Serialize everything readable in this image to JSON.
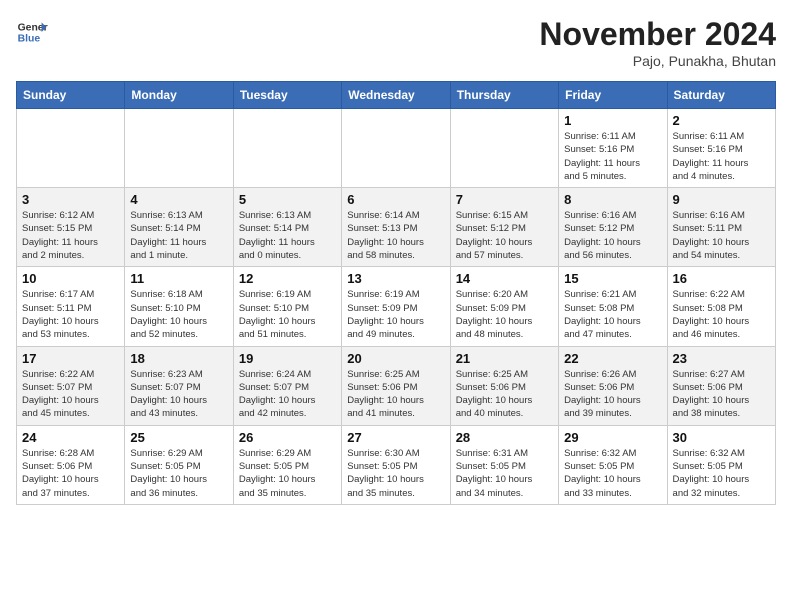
{
  "header": {
    "logo_line1": "General",
    "logo_line2": "Blue",
    "title": "November 2024",
    "subtitle": "Pajo, Punakha, Bhutan"
  },
  "weekdays": [
    "Sunday",
    "Monday",
    "Tuesday",
    "Wednesday",
    "Thursday",
    "Friday",
    "Saturday"
  ],
  "weeks": [
    [
      {
        "day": "",
        "info": ""
      },
      {
        "day": "",
        "info": ""
      },
      {
        "day": "",
        "info": ""
      },
      {
        "day": "",
        "info": ""
      },
      {
        "day": "",
        "info": ""
      },
      {
        "day": "1",
        "info": "Sunrise: 6:11 AM\nSunset: 5:16 PM\nDaylight: 11 hours\nand 5 minutes."
      },
      {
        "day": "2",
        "info": "Sunrise: 6:11 AM\nSunset: 5:16 PM\nDaylight: 11 hours\nand 4 minutes."
      }
    ],
    [
      {
        "day": "3",
        "info": "Sunrise: 6:12 AM\nSunset: 5:15 PM\nDaylight: 11 hours\nand 2 minutes."
      },
      {
        "day": "4",
        "info": "Sunrise: 6:13 AM\nSunset: 5:14 PM\nDaylight: 11 hours\nand 1 minute."
      },
      {
        "day": "5",
        "info": "Sunrise: 6:13 AM\nSunset: 5:14 PM\nDaylight: 11 hours\nand 0 minutes."
      },
      {
        "day": "6",
        "info": "Sunrise: 6:14 AM\nSunset: 5:13 PM\nDaylight: 10 hours\nand 58 minutes."
      },
      {
        "day": "7",
        "info": "Sunrise: 6:15 AM\nSunset: 5:12 PM\nDaylight: 10 hours\nand 57 minutes."
      },
      {
        "day": "8",
        "info": "Sunrise: 6:16 AM\nSunset: 5:12 PM\nDaylight: 10 hours\nand 56 minutes."
      },
      {
        "day": "9",
        "info": "Sunrise: 6:16 AM\nSunset: 5:11 PM\nDaylight: 10 hours\nand 54 minutes."
      }
    ],
    [
      {
        "day": "10",
        "info": "Sunrise: 6:17 AM\nSunset: 5:11 PM\nDaylight: 10 hours\nand 53 minutes."
      },
      {
        "day": "11",
        "info": "Sunrise: 6:18 AM\nSunset: 5:10 PM\nDaylight: 10 hours\nand 52 minutes."
      },
      {
        "day": "12",
        "info": "Sunrise: 6:19 AM\nSunset: 5:10 PM\nDaylight: 10 hours\nand 51 minutes."
      },
      {
        "day": "13",
        "info": "Sunrise: 6:19 AM\nSunset: 5:09 PM\nDaylight: 10 hours\nand 49 minutes."
      },
      {
        "day": "14",
        "info": "Sunrise: 6:20 AM\nSunset: 5:09 PM\nDaylight: 10 hours\nand 48 minutes."
      },
      {
        "day": "15",
        "info": "Sunrise: 6:21 AM\nSunset: 5:08 PM\nDaylight: 10 hours\nand 47 minutes."
      },
      {
        "day": "16",
        "info": "Sunrise: 6:22 AM\nSunset: 5:08 PM\nDaylight: 10 hours\nand 46 minutes."
      }
    ],
    [
      {
        "day": "17",
        "info": "Sunrise: 6:22 AM\nSunset: 5:07 PM\nDaylight: 10 hours\nand 45 minutes."
      },
      {
        "day": "18",
        "info": "Sunrise: 6:23 AM\nSunset: 5:07 PM\nDaylight: 10 hours\nand 43 minutes."
      },
      {
        "day": "19",
        "info": "Sunrise: 6:24 AM\nSunset: 5:07 PM\nDaylight: 10 hours\nand 42 minutes."
      },
      {
        "day": "20",
        "info": "Sunrise: 6:25 AM\nSunset: 5:06 PM\nDaylight: 10 hours\nand 41 minutes."
      },
      {
        "day": "21",
        "info": "Sunrise: 6:25 AM\nSunset: 5:06 PM\nDaylight: 10 hours\nand 40 minutes."
      },
      {
        "day": "22",
        "info": "Sunrise: 6:26 AM\nSunset: 5:06 PM\nDaylight: 10 hours\nand 39 minutes."
      },
      {
        "day": "23",
        "info": "Sunrise: 6:27 AM\nSunset: 5:06 PM\nDaylight: 10 hours\nand 38 minutes."
      }
    ],
    [
      {
        "day": "24",
        "info": "Sunrise: 6:28 AM\nSunset: 5:06 PM\nDaylight: 10 hours\nand 37 minutes."
      },
      {
        "day": "25",
        "info": "Sunrise: 6:29 AM\nSunset: 5:05 PM\nDaylight: 10 hours\nand 36 minutes."
      },
      {
        "day": "26",
        "info": "Sunrise: 6:29 AM\nSunset: 5:05 PM\nDaylight: 10 hours\nand 35 minutes."
      },
      {
        "day": "27",
        "info": "Sunrise: 6:30 AM\nSunset: 5:05 PM\nDaylight: 10 hours\nand 35 minutes."
      },
      {
        "day": "28",
        "info": "Sunrise: 6:31 AM\nSunset: 5:05 PM\nDaylight: 10 hours\nand 34 minutes."
      },
      {
        "day": "29",
        "info": "Sunrise: 6:32 AM\nSunset: 5:05 PM\nDaylight: 10 hours\nand 33 minutes."
      },
      {
        "day": "30",
        "info": "Sunrise: 6:32 AM\nSunset: 5:05 PM\nDaylight: 10 hours\nand 32 minutes."
      }
    ]
  ]
}
